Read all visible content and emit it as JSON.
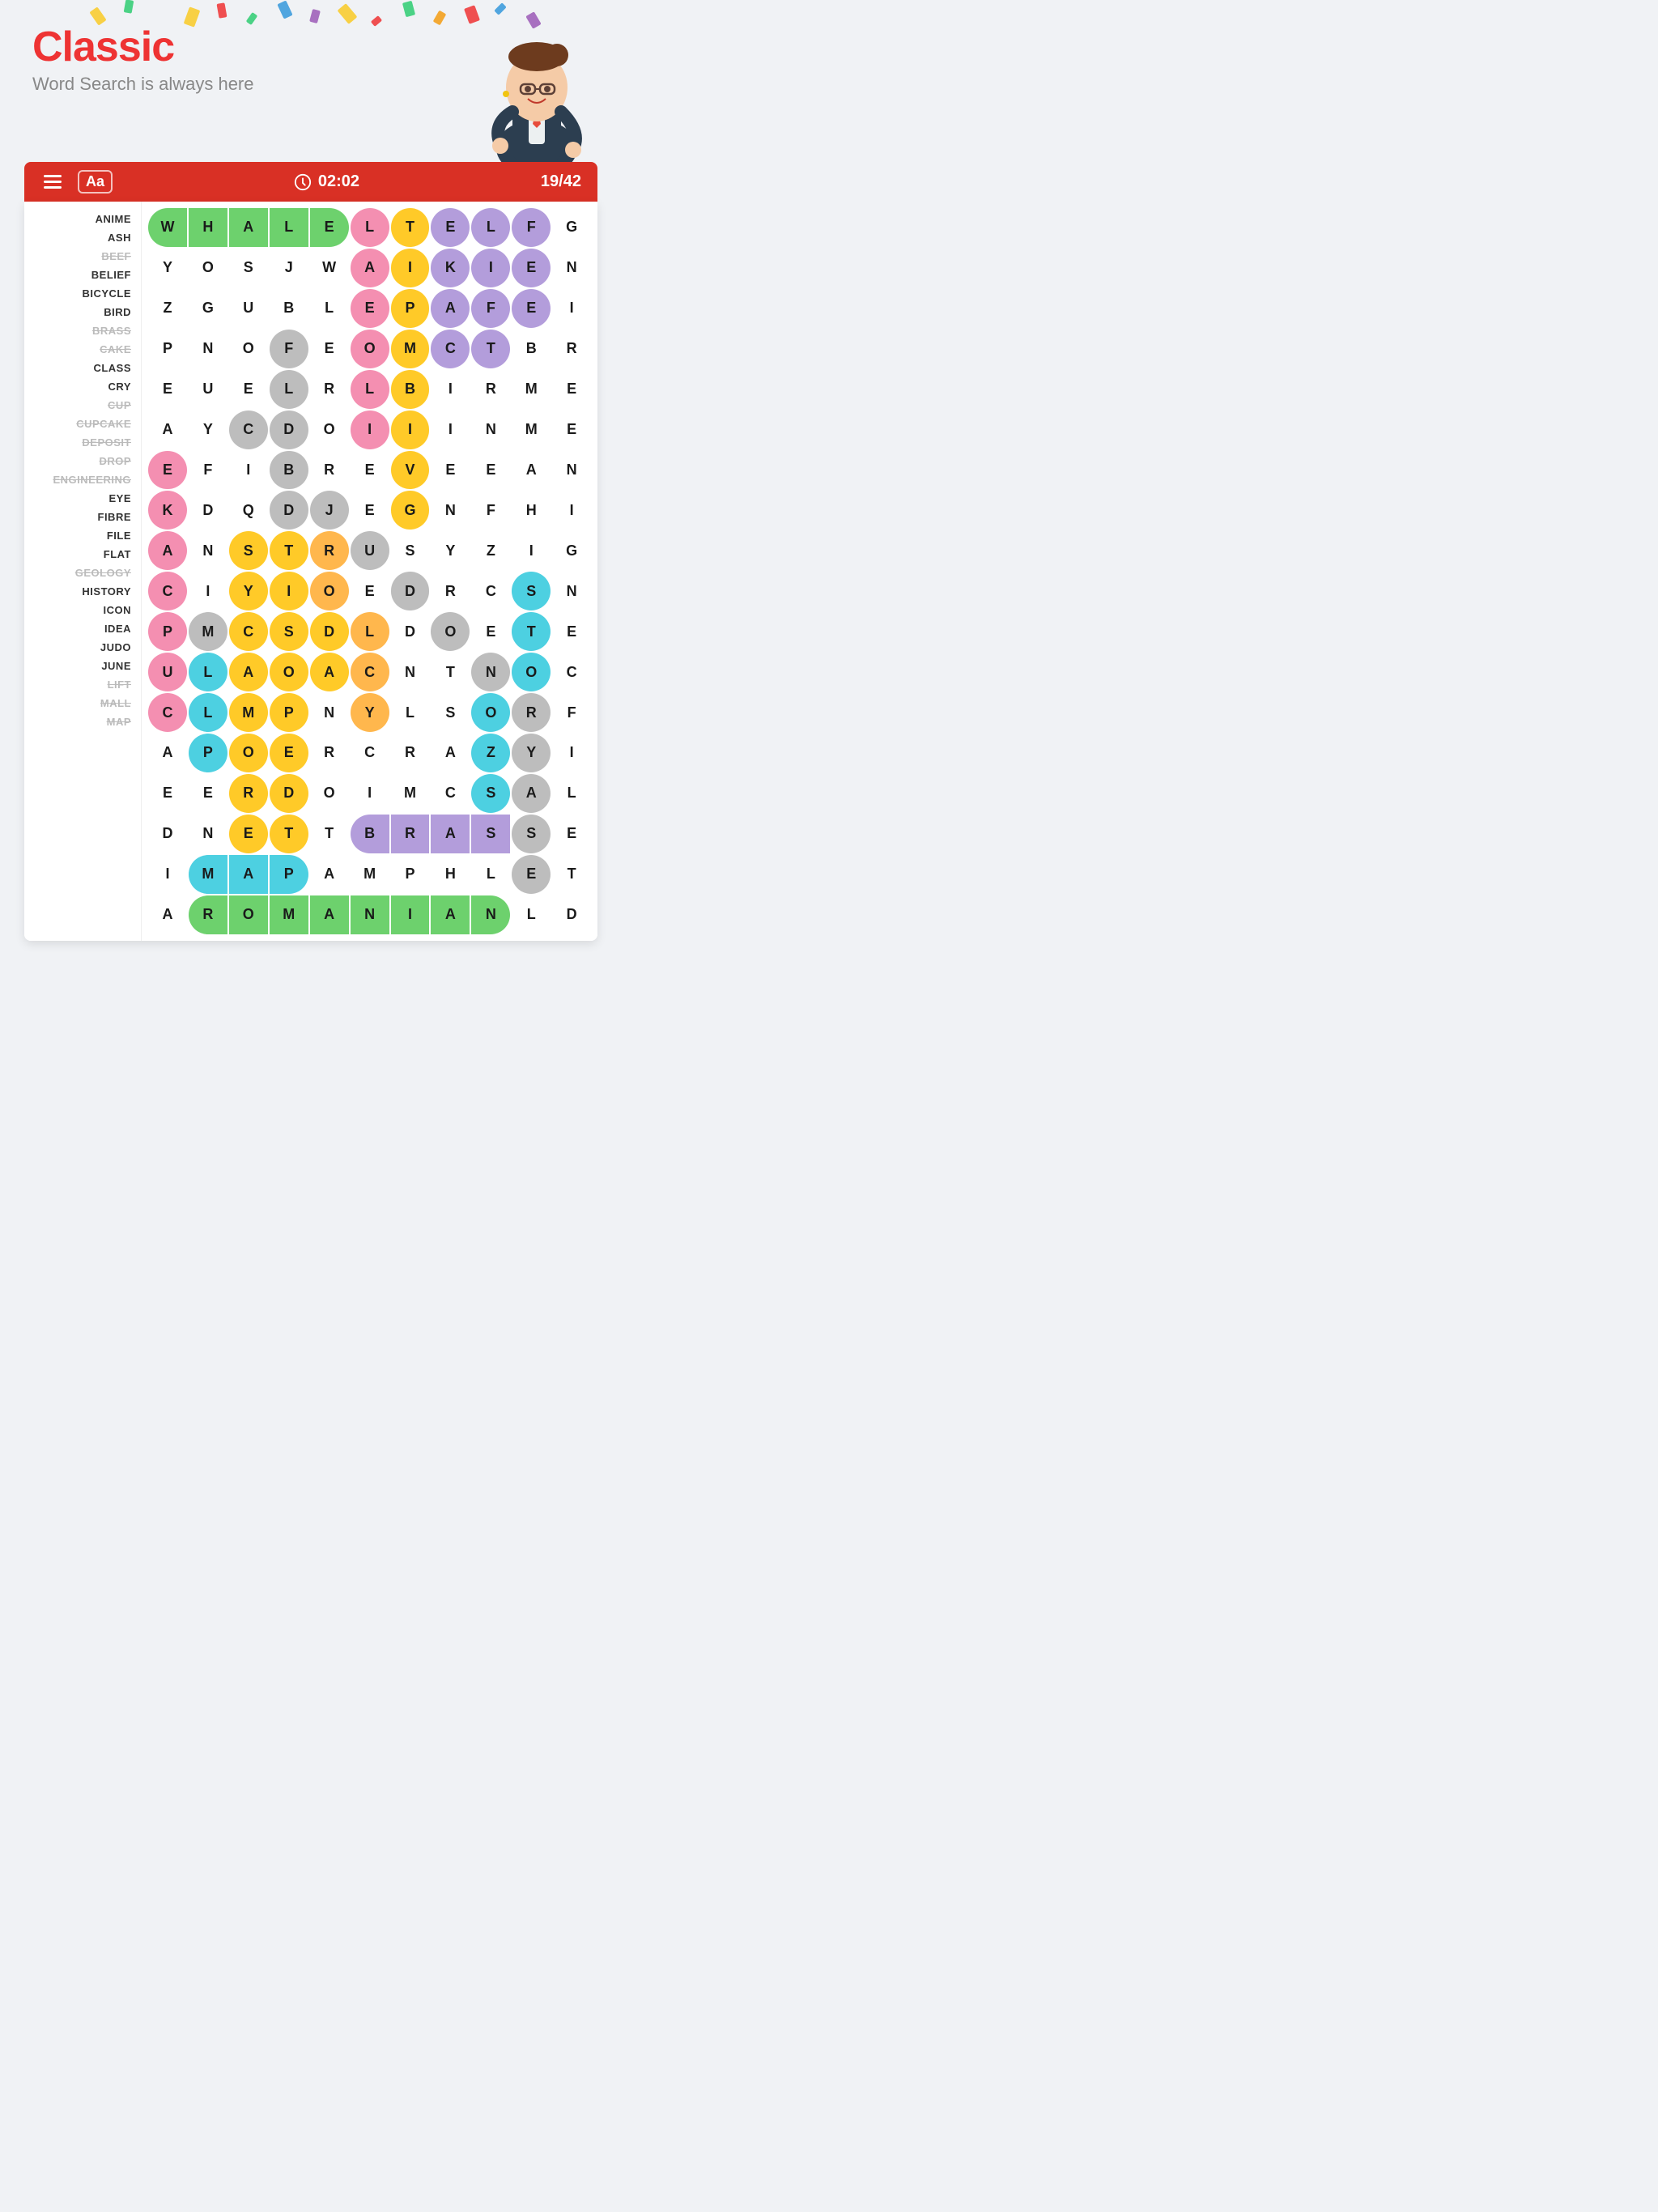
{
  "header": {
    "title": "Classic",
    "subtitle": "Word Search is always here",
    "character_alt": "Teacher character"
  },
  "toolbar": {
    "menu_label": "Menu",
    "font_label": "Aa",
    "timer": "02:02",
    "score": "19/42"
  },
  "wordlist": [
    {
      "word": "ANIME",
      "found": false
    },
    {
      "word": "ASH",
      "found": false
    },
    {
      "word": "BEEF",
      "found": true
    },
    {
      "word": "BELIEF",
      "found": false
    },
    {
      "word": "BICYCLE",
      "found": false
    },
    {
      "word": "BIRD",
      "found": false
    },
    {
      "word": "BRASS",
      "found": true
    },
    {
      "word": "CAKE",
      "found": true
    },
    {
      "word": "CLASS",
      "found": false
    },
    {
      "word": "CRY",
      "found": false
    },
    {
      "word": "CUP",
      "found": true
    },
    {
      "word": "CUPCAKE",
      "found": true
    },
    {
      "word": "DEPOSIT",
      "found": true
    },
    {
      "word": "DROP",
      "found": true
    },
    {
      "word": "ENGINEERING",
      "found": true
    },
    {
      "word": "EYE",
      "found": false
    },
    {
      "word": "FIBRE",
      "found": false
    },
    {
      "word": "FILE",
      "found": false
    },
    {
      "word": "FLAT",
      "found": false
    },
    {
      "word": "GEOLOGY",
      "found": true
    },
    {
      "word": "HISTORY",
      "found": false
    },
    {
      "word": "ICON",
      "found": false
    },
    {
      "word": "IDEA",
      "found": false
    },
    {
      "word": "JUDO",
      "found": false
    },
    {
      "word": "JUNE",
      "found": false
    },
    {
      "word": "LIFT",
      "found": true
    },
    {
      "word": "MALL",
      "found": true
    },
    {
      "word": "MAP",
      "found": true
    }
  ],
  "grid": {
    "rows": [
      [
        "W",
        "H",
        "A",
        "L",
        "E",
        "L",
        "T",
        "E",
        "L",
        "F",
        "G"
      ],
      [
        "Y",
        "O",
        "S",
        "J",
        "W",
        "A",
        "I",
        "K",
        "I",
        "E",
        "N"
      ],
      [
        "Z",
        "G",
        "U",
        "B",
        "L",
        "E",
        "P",
        "A",
        "F",
        "E",
        "I"
      ],
      [
        "P",
        "N",
        "O",
        "F",
        "E",
        "O",
        "M",
        "C",
        "T",
        "B",
        "R"
      ],
      [
        "E",
        "U",
        "E",
        "L",
        "R",
        "L",
        "B",
        "I",
        "R",
        "M",
        "E"
      ],
      [
        "A",
        "Y",
        "C",
        "D",
        "O",
        "I",
        "I",
        "I",
        "N",
        "M",
        "E"
      ],
      [
        "E",
        "F",
        "I",
        "B",
        "R",
        "E",
        "V",
        "E",
        "E",
        "A",
        "N"
      ],
      [
        "K",
        "D",
        "Q",
        "D",
        "J",
        "E",
        "G",
        "N",
        "F",
        "H",
        "I"
      ],
      [
        "A",
        "N",
        "S",
        "T",
        "R",
        "U",
        "S",
        "Y",
        "Z",
        "I",
        "G"
      ],
      [
        "C",
        "I",
        "Y",
        "I",
        "O",
        "E",
        "D",
        "R",
        "C",
        "S",
        "N"
      ],
      [
        "P",
        "M",
        "C",
        "S",
        "D",
        "L",
        "D",
        "O",
        "E",
        "T",
        "E"
      ],
      [
        "U",
        "L",
        "A",
        "O",
        "A",
        "C",
        "N",
        "T",
        "N",
        "O",
        "C"
      ],
      [
        "C",
        "L",
        "M",
        "P",
        "N",
        "Y",
        "L",
        "S",
        "O",
        "R",
        "F"
      ],
      [
        "A",
        "P",
        "O",
        "E",
        "R",
        "C",
        "R",
        "A",
        "Z",
        "Y",
        "I"
      ],
      [
        "E",
        "E",
        "R",
        "D",
        "O",
        "I",
        "M",
        "C",
        "S",
        "A",
        "L"
      ],
      [
        "D",
        "N",
        "E",
        "T",
        "T",
        "B",
        "R",
        "A",
        "S",
        "S",
        "E"
      ],
      [
        "I",
        "M",
        "A",
        "P",
        "A",
        "M",
        "P",
        "H",
        "L",
        "E",
        "T"
      ],
      [
        "A",
        "R",
        "O",
        "M",
        "A",
        "N",
        "I",
        "A",
        "N",
        "L",
        "D"
      ]
    ],
    "highlights": {}
  },
  "colors": {
    "red_accent": "#d93025",
    "green_highlight": "#6dd16d",
    "purple_highlight": "#b39ddb",
    "teal_highlight": "#4dd0e1",
    "yellow_highlight": "#ffca28",
    "pink_highlight": "#f48fb1",
    "orange_highlight": "#ffb74d",
    "gray_highlight": "#bdbdbd"
  }
}
